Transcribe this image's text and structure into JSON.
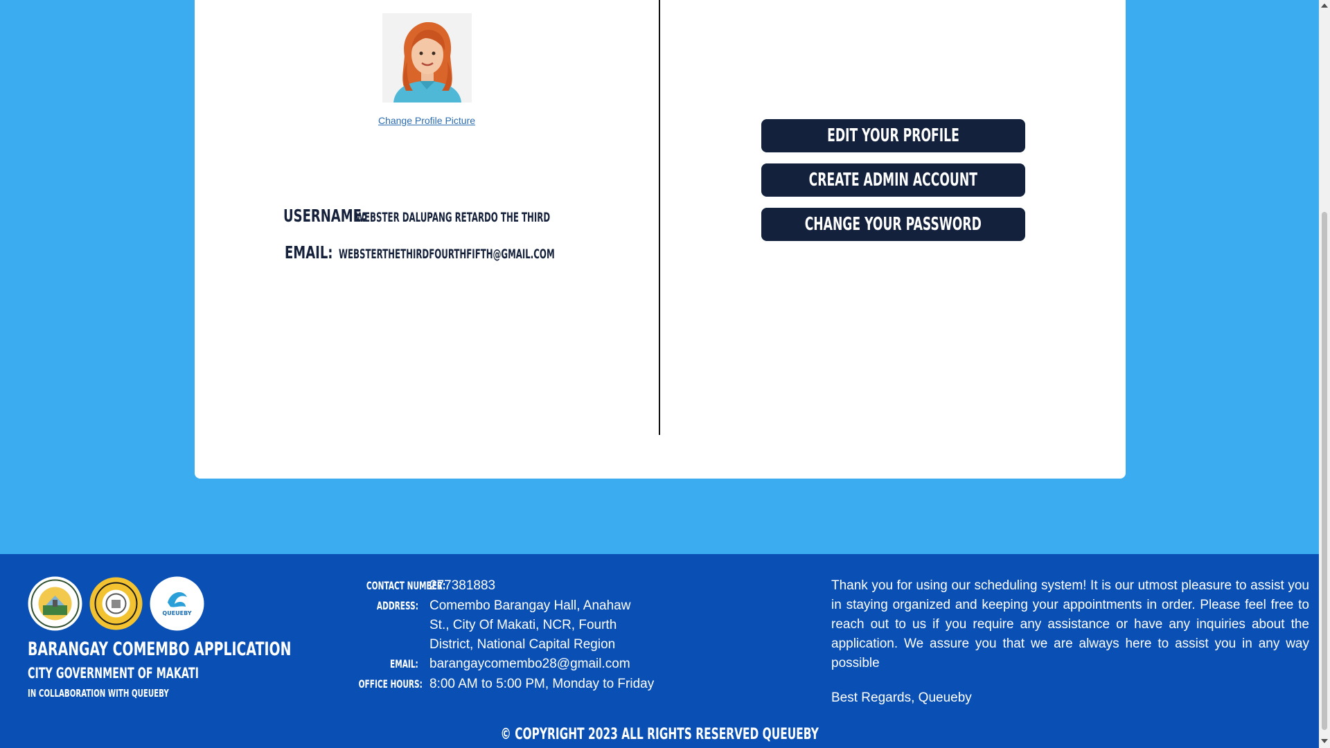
{
  "profile": {
    "change_picture_label": "Change Profile Picture",
    "username_label": "USERNAME:",
    "username_value": "WEBSTER DALUPANG RETARDO THE THIRD",
    "email_label": "EMAIL:",
    "email_value": "WEBSTERTHETHIRDFOURTHFIFTH@GMAIL.COM"
  },
  "actions": {
    "edit_profile": "EDIT YOUR PROFILE",
    "create_admin": "CREATE ADMIN ACCOUNT",
    "change_password": "CHANGE YOUR PASSWORD"
  },
  "footer": {
    "logos": [
      "makati-seal-icon",
      "comembo-seal-icon",
      "queueby-logo-icon"
    ],
    "queueby_logo_text": "QUEUEBY",
    "title": "BARANGAY COMEMBO APPLICATION",
    "subtitle": "CITY GOVERNMENT OF MAKATI",
    "collab": "IN COLLABORATION WITH QUEUEBY",
    "contact_number_label": "CONTACT NUMBER:",
    "contact_number": "277381883",
    "address_label": "ADDRESS:",
    "address": "Comembo Barangay Hall, Anahaw St., City Of Makati, NCR, Fourth District, National Capital Region",
    "email_label": "EMAIL:",
    "email": "barangaycomembo28@gmail.com",
    "office_hours_label": "OFFICE HOURS:",
    "office_hours": "8:00 AM to 5:00 PM, Monday to Friday",
    "thanks": "Thank you for using our scheduling system! It is our utmost pleasure to assist you in staying organized and keeping your appointments in order. Please feel free to reach out to us if you require any assistance or have any inquiries about the application. We assure you that we are always here to assist you in any way possible",
    "regards": "Best Regards, Queueby",
    "copyright": "© COPYRIGHT 2023 ALL RIGHTS RESERVED QUEUEBY"
  },
  "colors": {
    "background": "#3bacf0",
    "button": "#14213d",
    "footer": "#0a50b4",
    "link": "#2b6cb0"
  }
}
